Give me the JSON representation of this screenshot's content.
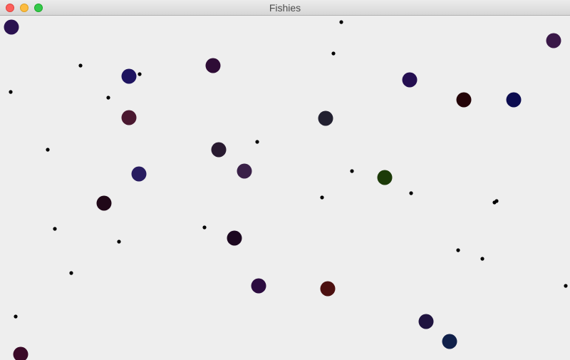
{
  "window": {
    "title": "Fishies",
    "controls": {
      "close_color": "#fc605c",
      "minimize_color": "#fdbc40",
      "zoom_color": "#34c84a"
    }
  },
  "scene": {
    "background_color": "#eeeeee",
    "fish": [
      {
        "color": "#2a1250"
      },
      {
        "color": "#3a1848"
      },
      {
        "color": "#1e1460"
      },
      {
        "color": "#2e0c36"
      },
      {
        "color": "#240e50"
      },
      {
        "color": "#240408"
      },
      {
        "color": "#0c0c50"
      },
      {
        "color": "#4a1830"
      },
      {
        "color": "#222030"
      },
      {
        "color": "#281a30"
      },
      {
        "color": "#3a2048"
      },
      {
        "color": "#281c60"
      },
      {
        "color": "#1c3a08"
      },
      {
        "color": "#200818"
      },
      {
        "color": "#1c0820"
      },
      {
        "color": "#2c0c40"
      },
      {
        "color": "#4c1010"
      },
      {
        "color": "#201440"
      },
      {
        "color": "#10204a"
      },
      {
        "color": "#3a0a28"
      }
    ],
    "food_color": "#000000",
    "food_count": 28
  }
}
